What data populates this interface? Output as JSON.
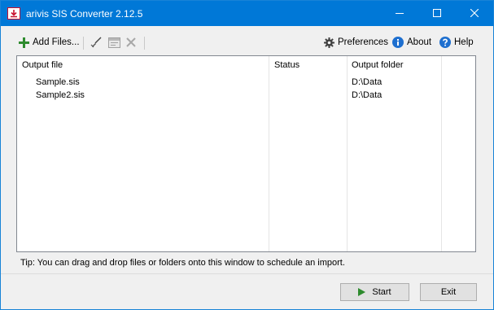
{
  "window": {
    "title": "arivis SIS Converter  2.12.5"
  },
  "toolbar": {
    "add_files_label": "Add Files...",
    "preferences_label": "Preferences",
    "about_label": "About",
    "help_label": "Help"
  },
  "list": {
    "columns": [
      "Output file",
      "Status",
      "Output folder"
    ],
    "rows": [
      {
        "file": "Sample.sis",
        "status": "",
        "folder": "D:\\Data"
      },
      {
        "file": "Sample2.sis",
        "status": "",
        "folder": "D:\\Data"
      }
    ]
  },
  "tip": "Tip: You can drag and drop files or folders onto this window to schedule an import.",
  "buttons": {
    "start_label": "Start",
    "exit_label": "Exit"
  },
  "colors": {
    "titlebar": "#0078d7",
    "add_icon": "#2e8b2e",
    "info_icon": "#1e6fcf",
    "start_icon": "#2e8b2e"
  }
}
